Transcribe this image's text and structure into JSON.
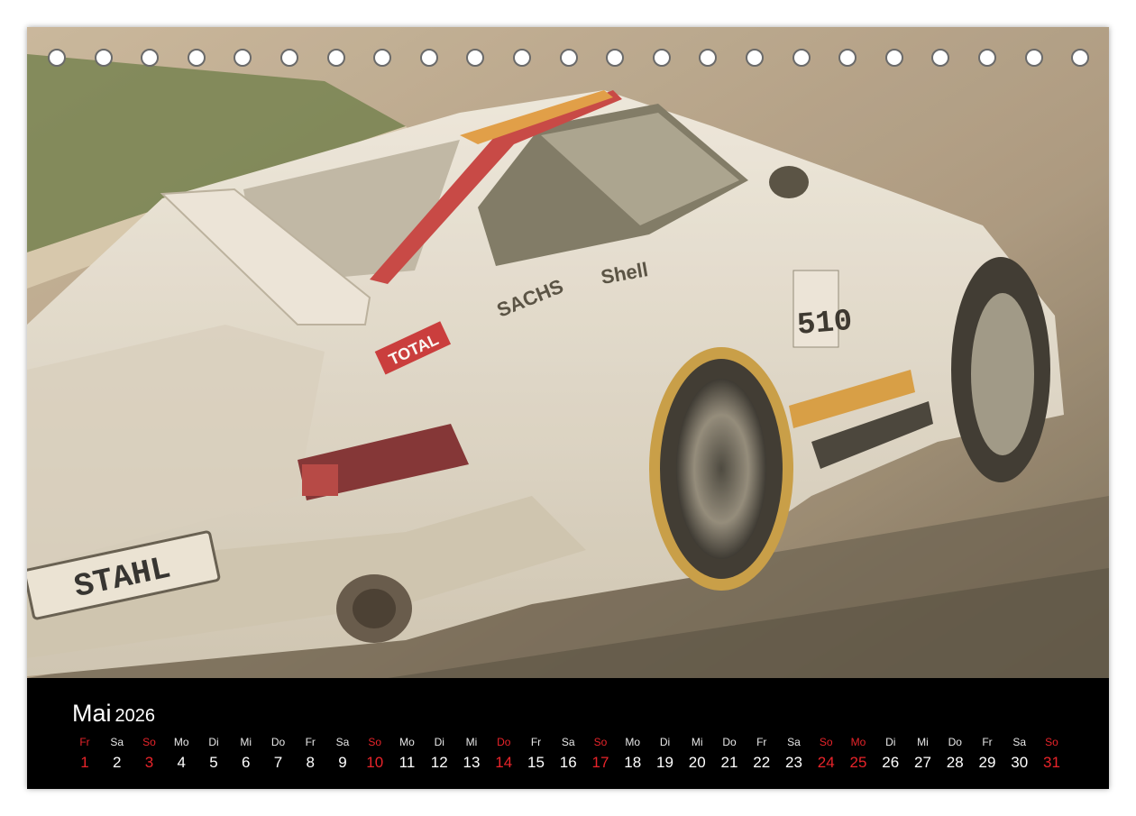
{
  "calendar": {
    "month": "Mai",
    "year": "2026",
    "accent_color": "#e8242a",
    "days": [
      {
        "name": "Fr",
        "num": "1",
        "holiday": true
      },
      {
        "name": "Sa",
        "num": "2",
        "holiday": false
      },
      {
        "name": "So",
        "num": "3",
        "holiday": true
      },
      {
        "name": "Mo",
        "num": "4",
        "holiday": false
      },
      {
        "name": "Di",
        "num": "5",
        "holiday": false
      },
      {
        "name": "Mi",
        "num": "6",
        "holiday": false
      },
      {
        "name": "Do",
        "num": "7",
        "holiday": false
      },
      {
        "name": "Fr",
        "num": "8",
        "holiday": false
      },
      {
        "name": "Sa",
        "num": "9",
        "holiday": false
      },
      {
        "name": "So",
        "num": "10",
        "holiday": true
      },
      {
        "name": "Mo",
        "num": "11",
        "holiday": false
      },
      {
        "name": "Di",
        "num": "12",
        "holiday": false
      },
      {
        "name": "Mi",
        "num": "13",
        "holiday": false
      },
      {
        "name": "Do",
        "num": "14",
        "holiday": true
      },
      {
        "name": "Fr",
        "num": "15",
        "holiday": false
      },
      {
        "name": "Sa",
        "num": "16",
        "holiday": false
      },
      {
        "name": "So",
        "num": "17",
        "holiday": true
      },
      {
        "name": "Mo",
        "num": "18",
        "holiday": false
      },
      {
        "name": "Di",
        "num": "19",
        "holiday": false
      },
      {
        "name": "Mi",
        "num": "20",
        "holiday": false
      },
      {
        "name": "Do",
        "num": "21",
        "holiday": false
      },
      {
        "name": "Fr",
        "num": "22",
        "holiday": false
      },
      {
        "name": "Sa",
        "num": "23",
        "holiday": false
      },
      {
        "name": "So",
        "num": "24",
        "holiday": true
      },
      {
        "name": "Mo",
        "num": "25",
        "holiday": true
      },
      {
        "name": "Di",
        "num": "26",
        "holiday": false
      },
      {
        "name": "Mi",
        "num": "27",
        "holiday": false
      },
      {
        "name": "Do",
        "num": "28",
        "holiday": false
      },
      {
        "name": "Fr",
        "num": "29",
        "holiday": false
      },
      {
        "name": "Sa",
        "num": "30",
        "holiday": false
      },
      {
        "name": "So",
        "num": "31",
        "holiday": true
      }
    ]
  },
  "photo": {
    "decals": {
      "total": "TOTAL",
      "shell": "Shell",
      "sachs": "SACHS",
      "plate": "STAHL",
      "number": "510"
    }
  }
}
